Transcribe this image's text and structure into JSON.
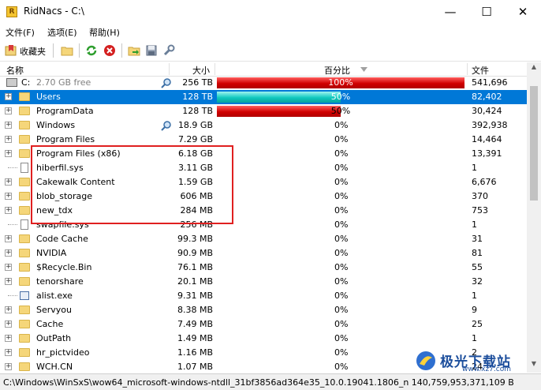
{
  "window": {
    "title": "RidNacs - C:\\",
    "app_icon_letter": "R",
    "minimize_glyph": "—",
    "maximize_glyph": "☐",
    "close_glyph": "✕"
  },
  "menu": [
    "文件(F)",
    "选项(E)",
    "帮助(H)"
  ],
  "toolbar": {
    "favorites_label": "收藏夹",
    "icons": [
      "favorites-icon",
      "open-folder-icon",
      "refresh-icon",
      "stop-icon",
      "export-icon",
      "save-icon",
      "settings-icon"
    ]
  },
  "columns": {
    "name": "名称",
    "size": "大小",
    "percent": "百分比",
    "files": "文件"
  },
  "drive": {
    "label": "C:",
    "free": "2.70 GB free",
    "size": "256 TB",
    "percent": "100%",
    "percent_value": 1.0,
    "files": "541,696"
  },
  "rows": [
    {
      "name": "Users",
      "size": "128 TB",
      "percent": "50%",
      "percent_value": 0.5,
      "files": "82,402",
      "type": "folder",
      "expandable": true,
      "selected": true,
      "scan": false
    },
    {
      "name": "ProgramData",
      "size": "128 TB",
      "percent": "50%",
      "percent_value": 0.5,
      "files": "30,424",
      "type": "folder",
      "expandable": true,
      "selected": false,
      "scan": false
    },
    {
      "name": "Windows",
      "size": "18.9 GB",
      "percent": "0%",
      "percent_value": 0,
      "files": "392,938",
      "type": "folder",
      "expandable": true,
      "selected": false,
      "scan": true
    },
    {
      "name": "Program Files",
      "size": "7.29 GB",
      "percent": "0%",
      "percent_value": 0,
      "files": "14,464",
      "type": "folder",
      "expandable": true,
      "selected": false,
      "scan": false
    },
    {
      "name": "Program Files (x86)",
      "size": "6.18 GB",
      "percent": "0%",
      "percent_value": 0,
      "files": "13,391",
      "type": "folder",
      "expandable": true,
      "selected": false,
      "scan": false
    },
    {
      "name": "hiberfil.sys",
      "size": "3.11 GB",
      "percent": "0%",
      "percent_value": 0,
      "files": "1",
      "type": "file",
      "expandable": false,
      "selected": false,
      "scan": false
    },
    {
      "name": "Cakewalk Content",
      "size": "1.59 GB",
      "percent": "0%",
      "percent_value": 0,
      "files": "6,676",
      "type": "folder",
      "expandable": true,
      "selected": false,
      "scan": false
    },
    {
      "name": "blob_storage",
      "size": "606 MB",
      "percent": "0%",
      "percent_value": 0,
      "files": "370",
      "type": "folder",
      "expandable": true,
      "selected": false,
      "scan": false
    },
    {
      "name": "new_tdx",
      "size": "284 MB",
      "percent": "0%",
      "percent_value": 0,
      "files": "753",
      "type": "folder",
      "expandable": true,
      "selected": false,
      "scan": false
    },
    {
      "name": "swapfile.sys",
      "size": "256 MB",
      "percent": "0%",
      "percent_value": 0,
      "files": "1",
      "type": "file",
      "expandable": false,
      "selected": false,
      "scan": false
    },
    {
      "name": "Code Cache",
      "size": "99.3 MB",
      "percent": "0%",
      "percent_value": 0,
      "files": "31",
      "type": "folder",
      "expandable": true,
      "selected": false,
      "scan": false
    },
    {
      "name": "NVIDIA",
      "size": "90.9 MB",
      "percent": "0%",
      "percent_value": 0,
      "files": "81",
      "type": "folder",
      "expandable": true,
      "selected": false,
      "scan": false
    },
    {
      "name": "$Recycle.Bin",
      "size": "76.1 MB",
      "percent": "0%",
      "percent_value": 0,
      "files": "55",
      "type": "folder",
      "expandable": true,
      "selected": false,
      "scan": false
    },
    {
      "name": "tenorshare",
      "size": "20.1 MB",
      "percent": "0%",
      "percent_value": 0,
      "files": "32",
      "type": "folder",
      "expandable": true,
      "selected": false,
      "scan": false
    },
    {
      "name": "alist.exe",
      "size": "9.31 MB",
      "percent": "0%",
      "percent_value": 0,
      "files": "1",
      "type": "exe",
      "expandable": false,
      "selected": false,
      "scan": false
    },
    {
      "name": "Servyou",
      "size": "8.38 MB",
      "percent": "0%",
      "percent_value": 0,
      "files": "9",
      "type": "folder",
      "expandable": true,
      "selected": false,
      "scan": false
    },
    {
      "name": "Cache",
      "size": "7.49 MB",
      "percent": "0%",
      "percent_value": 0,
      "files": "25",
      "type": "folder",
      "expandable": true,
      "selected": false,
      "scan": false
    },
    {
      "name": "OutPath",
      "size": "1.49 MB",
      "percent": "0%",
      "percent_value": 0,
      "files": "1",
      "type": "folder",
      "expandable": true,
      "selected": false,
      "scan": false
    },
    {
      "name": "hr_pictvideo",
      "size": "1.16 MB",
      "percent": "0%",
      "percent_value": 0,
      "files": "2",
      "type": "folder",
      "expandable": true,
      "selected": false,
      "scan": false
    },
    {
      "name": "WCH.CN",
      "size": "1.07 MB",
      "percent": "0%",
      "percent_value": 0,
      "files": "24",
      "type": "folder",
      "expandable": true,
      "selected": false,
      "scan": false
    }
  ],
  "status": "C:\\Windows\\WinSxS\\wow64_microsoft-windows-ntdll_31bf3856ad364e35_10.0.19041.1806_n 140,759,953,371,109 B",
  "watermark": {
    "text": "极光下载站",
    "url": "www.xz7.com"
  },
  "colors": {
    "selection": "#0078d7",
    "bar_red": "#d00000",
    "bar_cyan": "#10c9bf",
    "highlight": "#e02020"
  }
}
